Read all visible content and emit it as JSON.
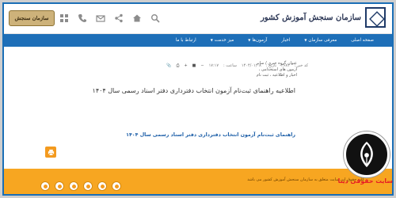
{
  "header": {
    "logo_text": "سازمان سنجش آموزش کشور",
    "badge_text": "سازمان سنجش",
    "icons": [
      "search-icon",
      "home-icon",
      "share-icon",
      "mail-icon",
      "phone-icon",
      "grid-icon"
    ]
  },
  "nav": {
    "items": [
      {
        "label": "صفحه اصلی"
      },
      {
        "label": "معرفی سازمان"
      },
      {
        "label": "اخبار"
      },
      {
        "label": "آزمون‌ها"
      },
      {
        "label": "میز خدمت"
      },
      {
        "label": "ارتباط با ما"
      }
    ]
  },
  "meta": {
    "code_label": "کد خبر :",
    "code_value": "۳۶۸۱",
    "date_label": "تاریخ :",
    "date_value": "۱۴۰۴/۰۱/۰۸",
    "time_label": "ساعت :",
    "time_value": "۱۷:۱۷"
  },
  "breadcrumbs": {
    "line1": "عنوان گروه خبری / سایر",
    "line2": "آزمون های استخدامی ،",
    "line3": "اخبار و اطلاعیه ، ثبت نام"
  },
  "article": {
    "title": "اطلاعیه راهنمای ثبت‌نام آزمون انتخاب دفترداری دفتر اسناد رسمی سال ۱۴۰۴",
    "doc_link": "راهنمای ثبت‌نام آزمون انتخاب دفترداری دفتر اسناد رسمی سال ۱۴۰۴"
  },
  "footer": {
    "text": "کلیه حقوق این سایت متعلق به سازمان سنجش آموزش کشور می باشد"
  },
  "watermark": {
    "text": "سایت حقوقی دینا"
  },
  "colors": {
    "nav_blue": "#1e6fb8",
    "footer_orange": "#f7a621",
    "link_blue": "#1d5fa8",
    "watermark_red": "#e61c24"
  }
}
